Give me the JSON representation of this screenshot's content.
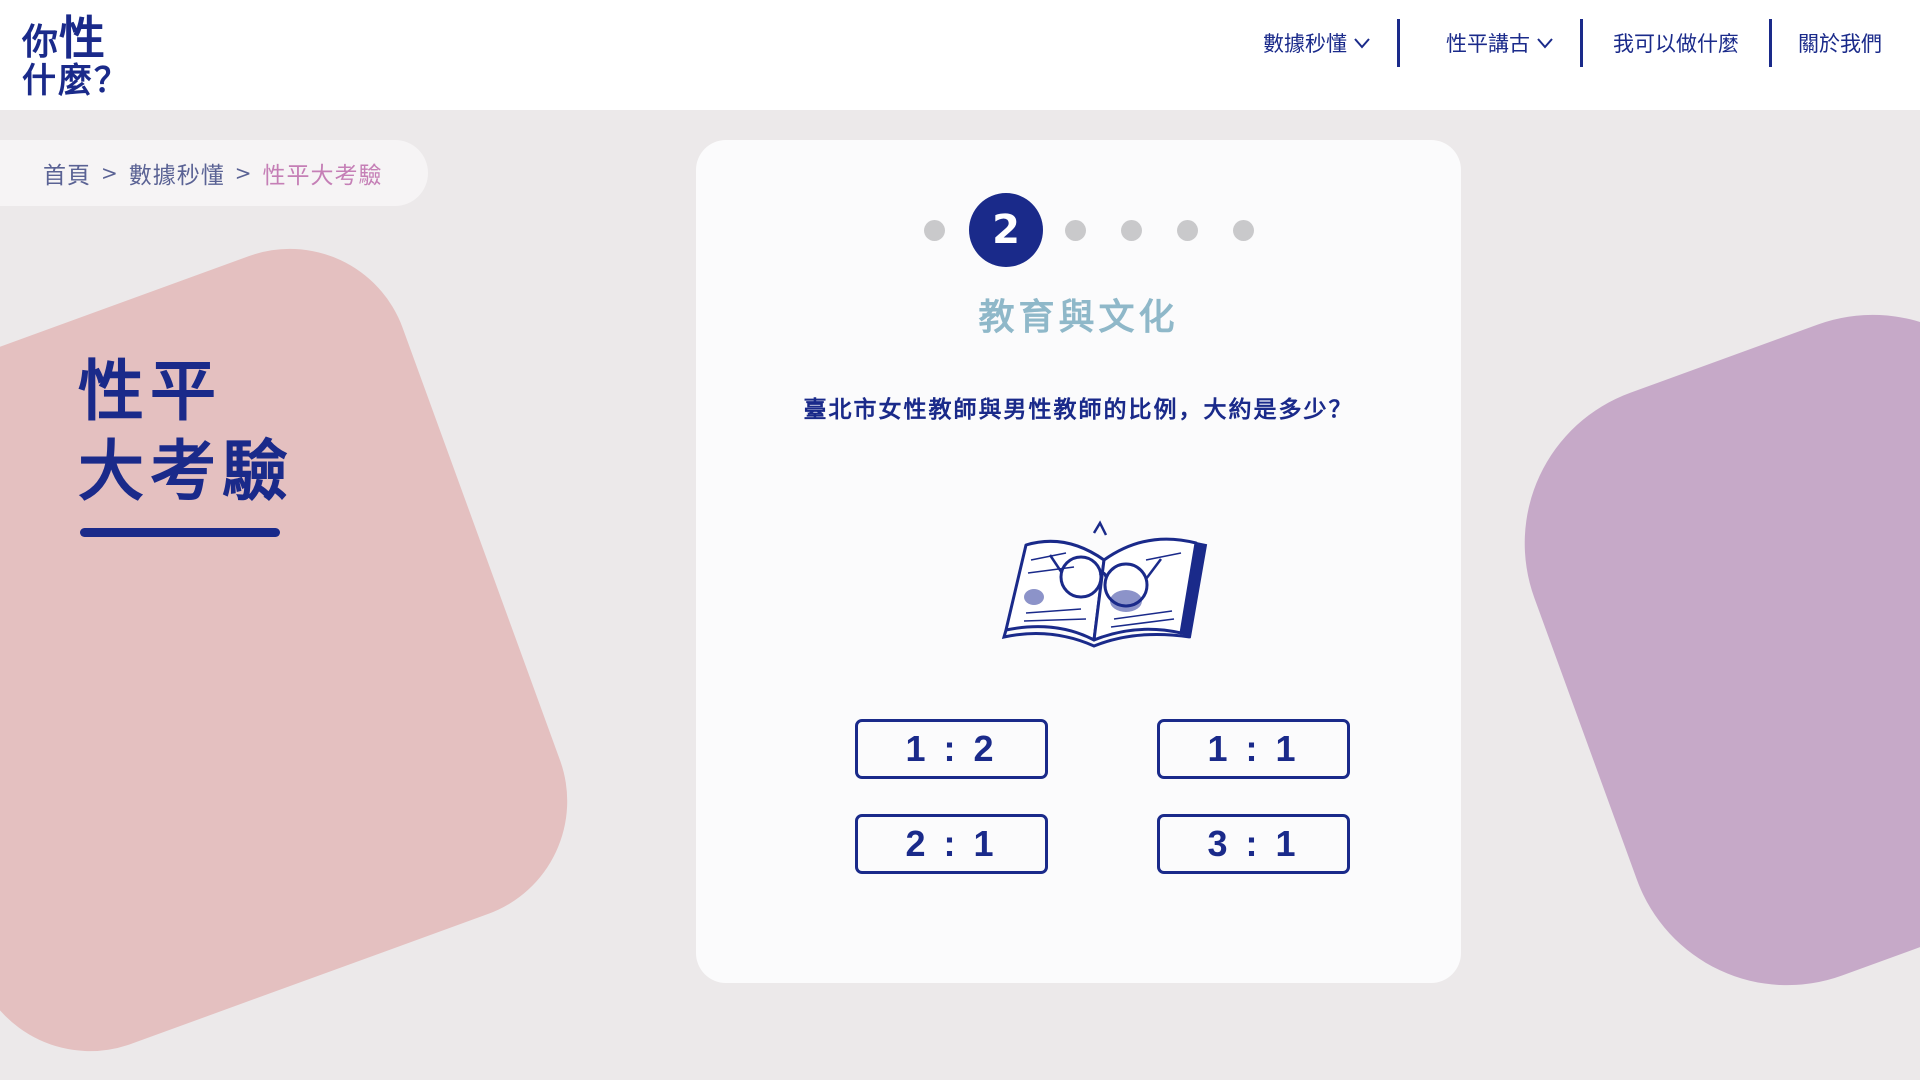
{
  "header": {
    "logo_line1_small": "你",
    "logo_line1_big": "性",
    "logo_line2": "什麼？",
    "nav": [
      {
        "label": "數據秒懂",
        "has_dropdown": true
      },
      {
        "label": "性平講古",
        "has_dropdown": true
      },
      {
        "label": "我可以做什麼",
        "has_dropdown": false
      },
      {
        "label": "關於我們",
        "has_dropdown": false
      }
    ]
  },
  "breadcrumb": {
    "home": "首頁",
    "separator": ">",
    "section": "數據秒懂",
    "current": "性平大考驗"
  },
  "page_title": {
    "line1": "性平",
    "line2": "大考驗"
  },
  "quiz": {
    "current_step": "2",
    "total_steps": 6,
    "category": "教育與文化",
    "question": "臺北市女性教師與男性教師的比例，大約是多少？",
    "illustration": "open-book-with-glasses",
    "answers": [
      "1 : 2",
      "1 : 1",
      "2 : 1",
      "3 : 1"
    ]
  },
  "colors": {
    "primary": "#1a2a8a",
    "category": "#8fb8c9",
    "breadcrumb_current": "#c57fb6",
    "blob_left": "#e4c0c0",
    "blob_right": "#c6a9c8",
    "step_inactive": "#c9c9cb"
  }
}
